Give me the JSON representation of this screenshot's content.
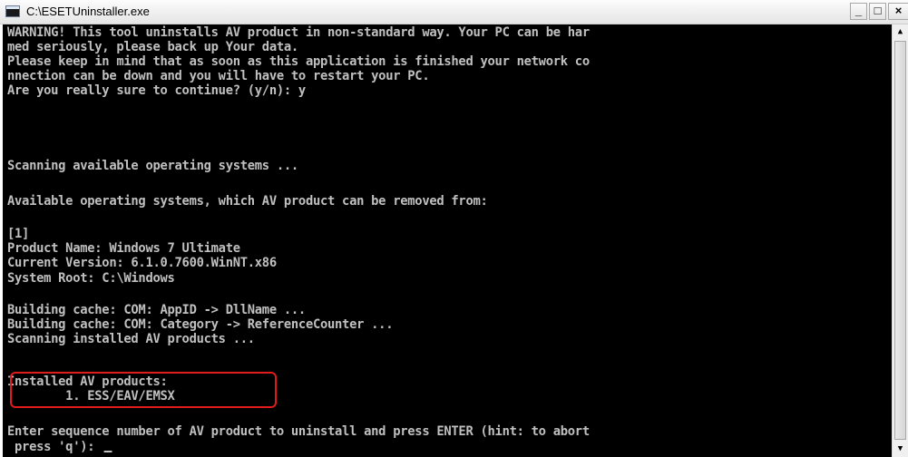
{
  "window": {
    "title": "C:\\ESETUninstaller.exe",
    "minimize_label": "_",
    "maximize_label": "□",
    "close_label": "×"
  },
  "console": {
    "lines": [
      "WARNING! This tool uninstalls AV product in non-standard way. Your PC can be har",
      "med seriously, please back up Your data.",
      "Please keep in mind that as soon as this application is finished your network co",
      "nnection can be down and you will have to restart your PC.",
      "Are you really sure to continue? (y/n): y",
      "Scanning available operating systems ...",
      "Available operating systems, which AV product can be removed from:",
      "[1]",
      "Product Name: Windows 7 Ultimate",
      "Current Version: 6.1.0.7600.WinNT.x86",
      "System Root: C:\\Windows",
      "Building cache: COM: AppID -> DllName ...",
      "Building cache: COM: Category -> ReferenceCounter ...",
      "Scanning installed AV products ...",
      "Installed AV products:",
      "        1. ESS/EAV/EMSX",
      "Enter sequence number of AV product to uninstall and press ENTER (hint: to abort",
      " press 'q'): "
    ]
  },
  "scrollbar": {
    "up_arrow": "▲",
    "down_arrow": "▼"
  },
  "colors": {
    "console_bg": "#000000",
    "console_text": "#c0c0c0",
    "highlight_border": "#e01b1b"
  }
}
